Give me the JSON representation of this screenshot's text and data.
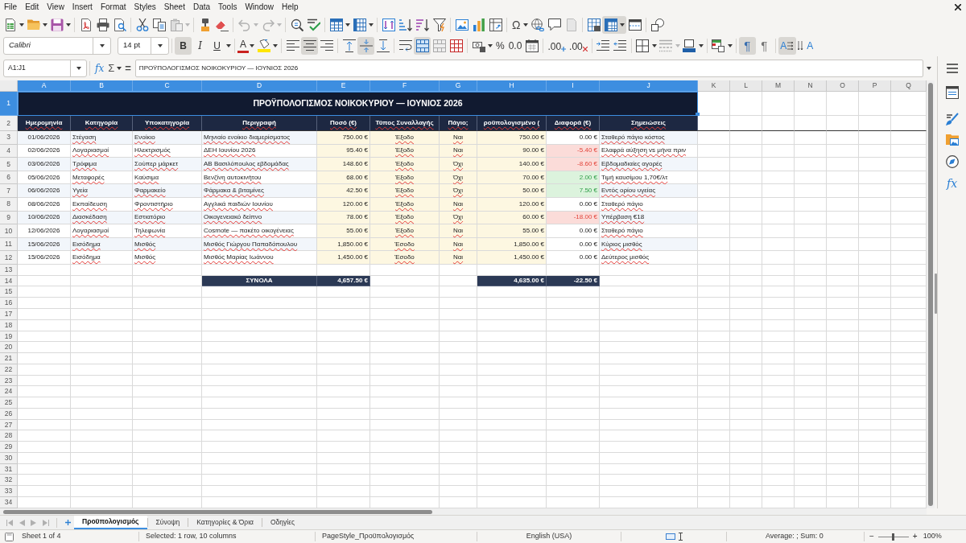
{
  "menu_bar": {
    "items": [
      "File",
      "Edit",
      "View",
      "Insert",
      "Format",
      "Styles",
      "Sheet",
      "Data",
      "Tools",
      "Window",
      "Help"
    ]
  },
  "standard_toolbar": {
    "special_character": "Ω",
    "freeze_pressed": true
  },
  "formatting_toolbar": {
    "font_name": "Calibri",
    "font_size": "14 pt",
    "bold": {
      "label": "B",
      "pressed": true
    },
    "italic": {
      "label": "I",
      "pressed": false
    },
    "underline": {
      "label": "U",
      "pressed": false
    },
    "font_color": "A",
    "horizontal_align": [
      {
        "selected": false
      },
      {
        "selected": true
      },
      {
        "selected": false
      }
    ],
    "vertical_align": [
      {
        "selected": false
      },
      {
        "selected": true
      },
      {
        "selected": false
      }
    ],
    "merge_center_pressed": true,
    "percent": "%",
    "standard_format": "0.0",
    "add_decimal": ".00",
    "delete_decimal": ".00",
    "paragraph_direction": [
      {
        "label": "¶",
        "selected": true
      },
      {
        "label": "¶",
        "selected": false
      }
    ],
    "text_direction": [
      {
        "label": "A",
        "selected": true
      },
      {
        "label": "A",
        "selected": false
      }
    ]
  },
  "formula_bar": {
    "name_box": "A1:J1",
    "function_wizard": "fx",
    "sum": "Σ",
    "formula": "=",
    "content": "ΠΡΟΫΠΟΛΟΓΙΣΜΟΣ ΝΟΙΚΟΚΥΡΙΟΥ — ΙΟΥΝΙΟΣ 2026"
  },
  "sheet": {
    "autospellcheck": true,
    "columns": [
      {
        "label": "A",
        "selected": true
      },
      {
        "label": "B",
        "selected": true
      },
      {
        "label": "C",
        "selected": true
      },
      {
        "label": "D",
        "selected": true
      },
      {
        "label": "E",
        "selected": true
      },
      {
        "label": "F",
        "selected": true
      },
      {
        "label": "G",
        "selected": true
      },
      {
        "label": "H",
        "selected": true
      },
      {
        "label": "I",
        "selected": true
      },
      {
        "label": "J",
        "selected": true
      },
      {
        "label": "K",
        "selected": false
      },
      {
        "label": "L",
        "selected": false
      },
      {
        "label": "M",
        "selected": false
      },
      {
        "label": "N",
        "selected": false
      },
      {
        "label": "O",
        "selected": false
      },
      {
        "label": "P",
        "selected": false
      },
      {
        "label": "Q",
        "selected": false
      }
    ],
    "rows": [
      {
        "label": "1",
        "selected": true
      },
      {
        "label": "2",
        "selected": false
      },
      {
        "label": "3",
        "selected": false
      },
      {
        "label": "4",
        "selected": false
      },
      {
        "label": "5",
        "selected": false
      },
      {
        "label": "6",
        "selected": false
      },
      {
        "label": "7",
        "selected": false
      },
      {
        "label": "8",
        "selected": false
      },
      {
        "label": "9",
        "selected": false
      },
      {
        "label": "10",
        "selected": false
      },
      {
        "label": "11",
        "selected": false
      },
      {
        "label": "12",
        "selected": false
      },
      {
        "label": "13",
        "selected": false
      },
      {
        "label": "14",
        "selected": false
      },
      {
        "label": "15",
        "selected": false
      },
      {
        "label": "16",
        "selected": false
      },
      {
        "label": "17",
        "selected": false
      },
      {
        "label": "18",
        "selected": false
      },
      {
        "label": "19",
        "selected": false
      },
      {
        "label": "20",
        "selected": false
      },
      {
        "label": "21",
        "selected": false
      },
      {
        "label": "22",
        "selected": false
      },
      {
        "label": "23",
        "selected": false
      },
      {
        "label": "24",
        "selected": false
      },
      {
        "label": "25",
        "selected": false
      },
      {
        "label": "26",
        "selected": false
      },
      {
        "label": "27",
        "selected": false
      },
      {
        "label": "28",
        "selected": false
      },
      {
        "label": "29",
        "selected": false
      },
      {
        "label": "30",
        "selected": false
      },
      {
        "label": "31",
        "selected": false
      },
      {
        "label": "32",
        "selected": false
      },
      {
        "label": "33",
        "selected": false
      },
      {
        "label": "34",
        "selected": false
      }
    ],
    "title": "ΠΡΟΫΠΟΛΟΓΙΣΜΟΣ ΝΟΙΚΟΚΥΡΙΟΥ — ΙΟΥΝΙΟΣ 2026",
    "headers": [
      "Ημερομηνία",
      "Κατηγορία",
      "Υποκατηγορία",
      "Περιγραφή",
      "Ποσό (€)",
      "Τύπος Συναλλαγής",
      "Πάγιο;",
      "ροϋπολογισμένο (",
      "Διαφορά (€)",
      "Σημειώσεις"
    ],
    "entries": [
      {
        "date": "01/06/2026",
        "category": "Στέγαση",
        "subcategory": "Ενοίκιο",
        "description": "Μηνιαίο ενοίκιο διαμερίσματος",
        "amount": "750.00 €",
        "type": "Έξοδο",
        "fixed": "Ναι",
        "budgeted": "750.00 €",
        "difference": "0.00 €",
        "over_budget": false,
        "under_budget": false,
        "notes": "Σταθερό πάγιο κόστος"
      },
      {
        "date": "02/06/2026",
        "category": "Λογαριασμοί",
        "subcategory": "Ηλεκτρισμός",
        "description": "ΔΕΗ Ιουνίου 2026",
        "amount": "95.40 €",
        "type": "Έξοδο",
        "fixed": "Ναι",
        "budgeted": "90.00 €",
        "difference": "-5.40 €",
        "over_budget": true,
        "under_budget": false,
        "notes": "Ελαφρά αύξηση vs μήνα πριν"
      },
      {
        "date": "03/06/2026",
        "category": "Τρόφιμα",
        "subcategory": "Σούπερ μάρκετ",
        "description": "ΑΒ Βασιλόπουλος εβδομάδας",
        "amount": "148.60 €",
        "type": "Έξοδο",
        "fixed": "Όχι",
        "budgeted": "140.00 €",
        "difference": "-8.60 €",
        "over_budget": true,
        "under_budget": false,
        "notes": "Εβδομαδιαίες αγορές"
      },
      {
        "date": "05/06/2026",
        "category": "Μεταφορές",
        "subcategory": "Καύσιμα",
        "description": "Βενζίνη αυτοκινήτου",
        "amount": "68.00 €",
        "type": "Έξοδο",
        "fixed": "Όχι",
        "budgeted": "70.00 €",
        "difference": "2.00 €",
        "over_budget": false,
        "under_budget": true,
        "notes": "Τιμή καυσίμου 1,70€/λτ"
      },
      {
        "date": "06/06/2026",
        "category": "Υγεία",
        "subcategory": "Φαρμακείο",
        "description": "Φάρμακα & βιταμίνες",
        "amount": "42.50 €",
        "type": "Έξοδο",
        "fixed": "Όχι",
        "budgeted": "50.00 €",
        "difference": "7.50 €",
        "over_budget": false,
        "under_budget": true,
        "notes": "Εντός ορίου υγείας"
      },
      {
        "date": "08/06/2026",
        "category": "Εκπαίδευση",
        "subcategory": "Φροντιστήριο",
        "description": "Αγγλικά παιδιών Ιουνίου",
        "amount": "120.00 €",
        "type": "Έξοδο",
        "fixed": "Ναι",
        "budgeted": "120.00 €",
        "difference": "0.00 €",
        "over_budget": false,
        "under_budget": false,
        "notes": "Σταθερό πάγιο"
      },
      {
        "date": "10/06/2026",
        "category": "Διασκέδαση",
        "subcategory": "Εστιατόριο",
        "description": "Οικογενειακό δείπνο",
        "amount": "78.00 €",
        "type": "Έξοδο",
        "fixed": "Όχι",
        "budgeted": "60.00 €",
        "difference": "-18.00 €",
        "over_budget": true,
        "under_budget": false,
        "notes": "Υπέρβαση €18"
      },
      {
        "date": "12/06/2026",
        "category": "Λογαριασμοί",
        "subcategory": "Τηλεφωνία",
        "description": "Cosmote — πακέτο οικογένειας",
        "amount": "55.00 €",
        "type": "Έξοδο",
        "fixed": "Ναι",
        "budgeted": "55.00 €",
        "difference": "0.00 €",
        "over_budget": false,
        "under_budget": false,
        "notes": "Σταθερό πάγιο"
      },
      {
        "date": "15/06/2026",
        "category": "Εισόδημα",
        "subcategory": "Μισθός",
        "description": "Μισθός Γιώργου Παπαδόπουλου",
        "amount": "1,850.00 €",
        "type": "Έσοδο",
        "fixed": "Ναι",
        "budgeted": "1,850.00 €",
        "difference": "0.00 €",
        "over_budget": false,
        "under_budget": false,
        "notes": "Κύριος μισθός"
      },
      {
        "date": "15/06/2026",
        "category": "Εισόδημα",
        "subcategory": "Μισθός",
        "description": "Μισθός Μαρίας Ιωάννου",
        "amount": "1,450.00 €",
        "type": "Έσοδο",
        "fixed": "Ναι",
        "budgeted": "1,450.00 €",
        "difference": "0.00 €",
        "over_budget": false,
        "under_budget": false,
        "notes": "Δεύτερος μισθός"
      }
    ],
    "totals": {
      "label": "ΣΥΝΟΛΑ",
      "amount": "4,657.50 €",
      "budgeted": "4,635.00 €",
      "difference": "-22.50 €"
    }
  },
  "sidebar": {
    "functions": "fx"
  },
  "sheet_tabs": [
    {
      "label": "Προϋπολογισμός",
      "selected": true
    },
    {
      "label": "Σύνοψη",
      "selected": false
    },
    {
      "label": "Κατηγορίες & Όρια",
      "selected": false
    },
    {
      "label": "Οδηγίες",
      "selected": false
    }
  ],
  "status_bar": {
    "sheet": "Sheet 1 of 4",
    "selection": "Selected: 1 row, 10 columns",
    "page_style": "PageStyle_Προϋπολογισμός",
    "language": "English (USA)",
    "summary": "Average: ; Sum: 0",
    "zoom": {
      "zoom_out": "−",
      "zoom_in": "+",
      "level": 0.5,
      "percent": "100%"
    }
  }
}
